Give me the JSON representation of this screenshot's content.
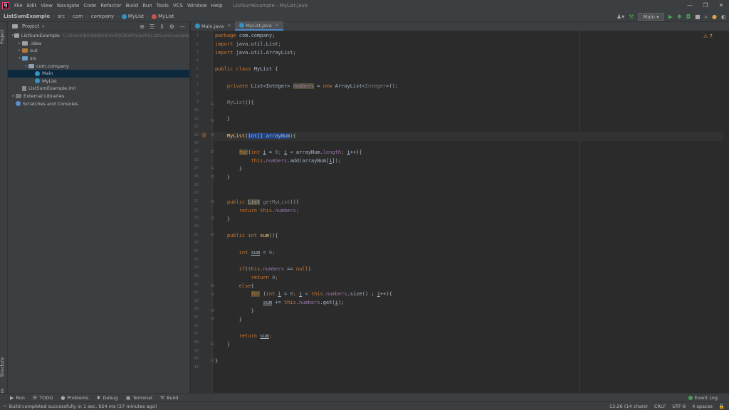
{
  "window": {
    "title": "ListSumExample - MyList.java",
    "logo": "IJ",
    "menu": [
      "File",
      "Edit",
      "View",
      "Navigate",
      "Code",
      "Refactor",
      "Build",
      "Run",
      "Tools",
      "VCS",
      "Window",
      "Help"
    ],
    "controls": [
      "—",
      "❐",
      "✕"
    ]
  },
  "breadcrumbs": [
    "ListSumExample",
    "src",
    "com",
    "company",
    "MyList",
    "MyList"
  ],
  "toolbar": {
    "run_config": "Main ▾",
    "icons": [
      "user-icon",
      "hammer-icon",
      "run-icon",
      "debug-icon",
      "coverage-icon",
      "stop-icon",
      "search-icon",
      "settings-icon",
      "update-icon"
    ]
  },
  "side_tabs": {
    "project": "Project",
    "structure": "Structure",
    "favorites": "Favorites"
  },
  "project_panel": {
    "title": "Project",
    "tree": [
      {
        "label": "ListSumExample",
        "extra": "C:\\Users\\Bellatdot\\IntelliJIDEAProjects\\ListSumExample",
        "indent": 0,
        "twisty": "▾",
        "icon": "folder"
      },
      {
        "label": ".idea",
        "extra": "",
        "indent": 1,
        "twisty": "▸",
        "icon": "folder"
      },
      {
        "label": "out",
        "extra": "",
        "indent": 1,
        "twisty": "▸",
        "icon": "folder-o"
      },
      {
        "label": "src",
        "extra": "",
        "indent": 1,
        "twisty": "▾",
        "icon": "folder-b"
      },
      {
        "label": "com.company",
        "extra": "",
        "indent": 2,
        "twisty": "▾",
        "icon": "pkg"
      },
      {
        "label": "Main",
        "extra": "",
        "indent": 3,
        "twisty": "",
        "icon": "cls",
        "selected": true
      },
      {
        "label": "MyList",
        "extra": "",
        "indent": 3,
        "twisty": "",
        "icon": "cls"
      },
      {
        "label": "ListSumExample.iml",
        "extra": "",
        "indent": 1,
        "twisty": "",
        "icon": "file"
      },
      {
        "label": "External Libraries",
        "extra": "",
        "indent": 0,
        "twisty": "▸",
        "icon": "lib"
      },
      {
        "label": "Scratches and Consoles",
        "extra": "",
        "indent": 0,
        "twisty": "",
        "icon": "scratch"
      }
    ]
  },
  "tabs": [
    {
      "label": "Main.java",
      "active": false
    },
    {
      "label": "MyList.java",
      "active": true
    }
  ],
  "editor": {
    "warnings": "⚠ 7",
    "lines": [
      "1",
      "2",
      "3",
      "4",
      "5",
      "6",
      "7",
      "8",
      "9",
      "10",
      "11",
      "12",
      "13",
      "14",
      "15",
      "16",
      "17",
      "18",
      "19",
      "20",
      "21",
      "22",
      "23",
      "24",
      "25",
      "26",
      "27",
      "28",
      "29",
      "30",
      "31",
      "32",
      "33",
      "34",
      "35",
      "36",
      "37",
      "38",
      "39",
      "40",
      "41"
    ],
    "code": {
      "l1a": "package",
      "l1b": " com.company;",
      "l2a": "import",
      "l2b": " java.util.List;",
      "l3a": "import",
      "l3b": " java.util.ArrayList;",
      "l5a": "public class",
      "l5b": " MyList {",
      "l7a": "    private",
      "l7b": " List<Integer> ",
      "l7c": "numbers",
      "l7d": " = ",
      "l7e": "new",
      "l7f": " ArrayList<",
      "l7g": "Integer",
      "l7h": ">();",
      "l9a": "    MyList",
      "l9b": "(){",
      "l11a": "    }",
      "l13a": "    MyList(",
      "l13b": "int[] arrayNum",
      "l13c": "){",
      "l15a": "        ",
      "l15b": "for",
      "l15c": "(",
      "l15d": "int",
      "l15e": " ",
      "l15f": "i",
      "l15g": " = ",
      "l15h": "0",
      "l15i": "; ",
      "l15j": "i",
      "l15k": " < arrayNum.",
      "l15l": "length",
      "l15m": "; ",
      "l15n": "i",
      "l15o": "++){",
      "l16a": "            ",
      "l16b": "this",
      "l16c": ".",
      "l16d": "numbers",
      "l16e": ".add(arrayNum[",
      "l16f": "i",
      "l16g": "]);",
      "l17a": "        }",
      "l18a": "    }",
      "l21a": "    public",
      "l21b": " ",
      "l21c": "List",
      "l21d": " getMyList",
      "l21e": "(){",
      "l22a": "        return",
      "l22b": " ",
      "l22c": "this",
      "l22d": ".",
      "l22e": "numbers",
      "l22f": ";",
      "l23a": "    }",
      "l25a": "    public int",
      "l25b": " ",
      "l25c": "sum",
      "l25d": "(){",
      "l27a": "        int",
      "l27b": " ",
      "l27c": "sum",
      "l27d": " = ",
      "l27e": "0",
      "l27f": ";",
      "l29a": "        if",
      "l29b": "(",
      "l29c": "this",
      "l29d": ".",
      "l29e": "numbers",
      "l29f": " == ",
      "l29g": "null",
      "l29h": ")",
      "l30a": "            return",
      "l30b": " ",
      "l30c": "0",
      "l30d": ";",
      "l31a": "        else",
      "l31b": "{",
      "l32a": "            ",
      "l32b": "for",
      "l32c": " (",
      "l32d": "int",
      "l32e": " ",
      "l32f": "i",
      "l32g": " = ",
      "l32h": "0",
      "l32i": "; ",
      "l32j": "i",
      "l32k": " < ",
      "l32l": "this",
      "l32m": ".",
      "l32n": "numbers",
      "l32o": ".size() ; ",
      "l32p": "i",
      "l32q": "++){",
      "l33a": "                ",
      "l33b": "sum",
      "l33c": " += ",
      "l33d": "this",
      "l33e": ".",
      "l33f": "numbers",
      "l33g": ".get(",
      "l33h": "i",
      "l33i": ");",
      "l34a": "            }",
      "l35a": "        }",
      "l37a": "        return",
      "l37b": " ",
      "l37c": "sum",
      "l37d": ";",
      "l38a": "    }",
      "l40a": "}"
    }
  },
  "bottom_tools": [
    {
      "icon": "▶",
      "label": "Run"
    },
    {
      "icon": "☰",
      "label": "TODO"
    },
    {
      "icon": "●",
      "label": "Problems"
    },
    {
      "icon": "✱",
      "label": "Debug"
    },
    {
      "icon": "▣",
      "label": "Terminal"
    },
    {
      "icon": "⚒",
      "label": "Build"
    }
  ],
  "event_log": "Event Log",
  "status": {
    "message": "Build completed successfully in 1 sec, 924 ms (27 minutes ago)",
    "position": "13:26 (14 chars)",
    "line_sep": "CRLF",
    "encoding": "UTF-8",
    "indent": "4 spaces"
  },
  "colors": {
    "keyword": "#cc7832",
    "field": "#9876aa",
    "method": "#ffc66d",
    "number": "#6897bb",
    "selection": "#214283"
  }
}
